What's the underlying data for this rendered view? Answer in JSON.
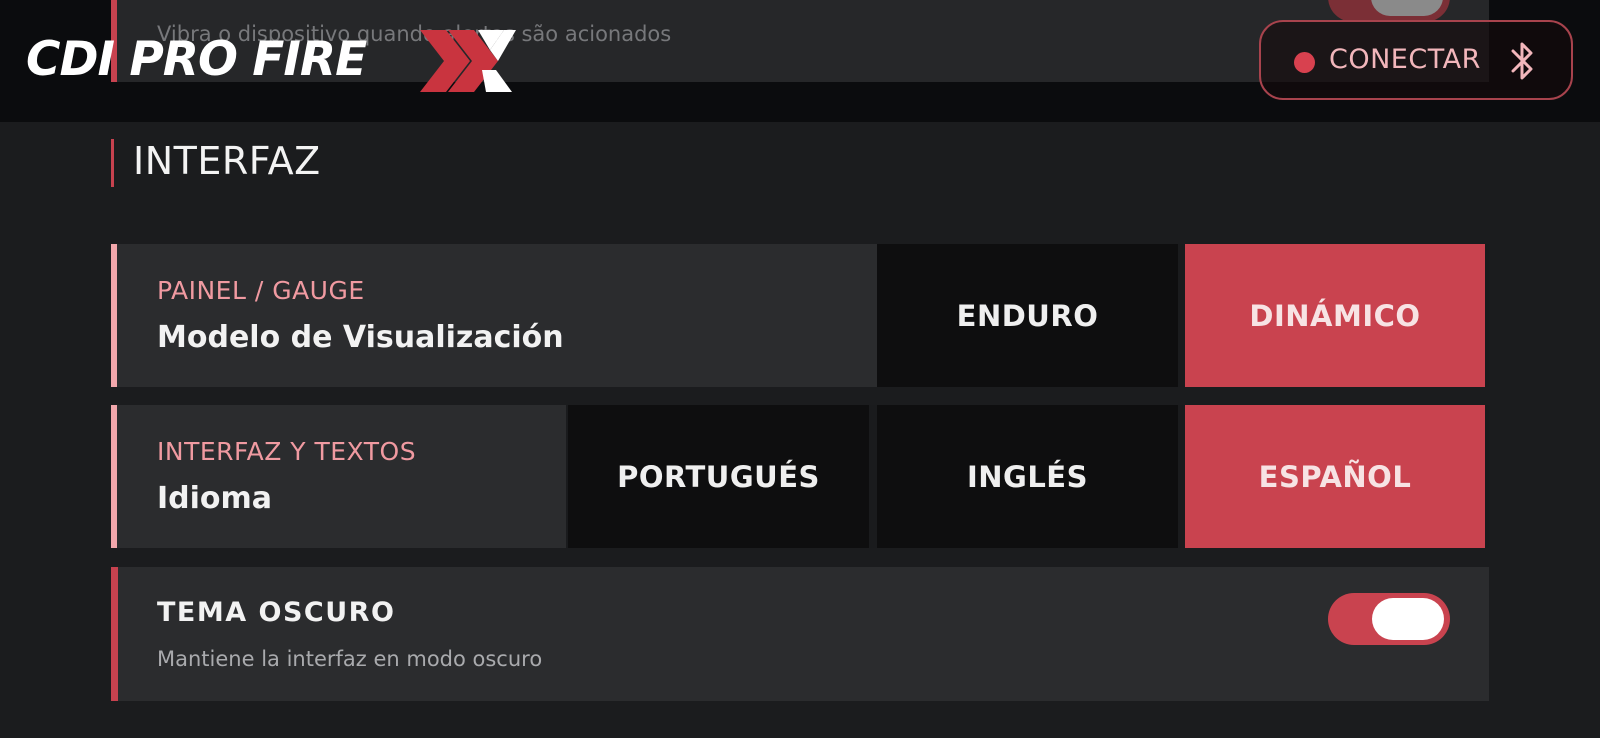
{
  "header": {
    "previous_card_description": "Vibra o dispositivo quando alertas são acionados",
    "brand": "CDI PRO FIRE",
    "brand_mark_icon": "double-chevron-x-logo-icon",
    "connect": {
      "label": "CONECTAR",
      "status_icon": "status-dot-icon",
      "icon": "bluetooth-icon"
    }
  },
  "section": {
    "title": "INTERFAZ"
  },
  "gauge_setting": {
    "subtitle": "PAINEL / GAUGE",
    "title": "Modelo de Visualización",
    "options": [
      "ENDURO",
      "DINÁMICO"
    ],
    "selected": "DINÁMICO"
  },
  "language_setting": {
    "subtitle": "INTERFAZ Y TEXTOS",
    "title": "Idioma",
    "options": [
      "PORTUGUÉS",
      "INGLÉS",
      "ESPAÑOL"
    ],
    "selected": "ESPAÑOL"
  },
  "dark_theme": {
    "title": "TEMA OSCURO",
    "description": "Mantiene la interfaz en modo oscuro",
    "enabled": true
  },
  "colors": {
    "accent": "#c9434f",
    "accent_light": "#f09aa1",
    "background": "#1b1c1e",
    "card": "#2b2c2e",
    "header": "#0b0c0e"
  }
}
